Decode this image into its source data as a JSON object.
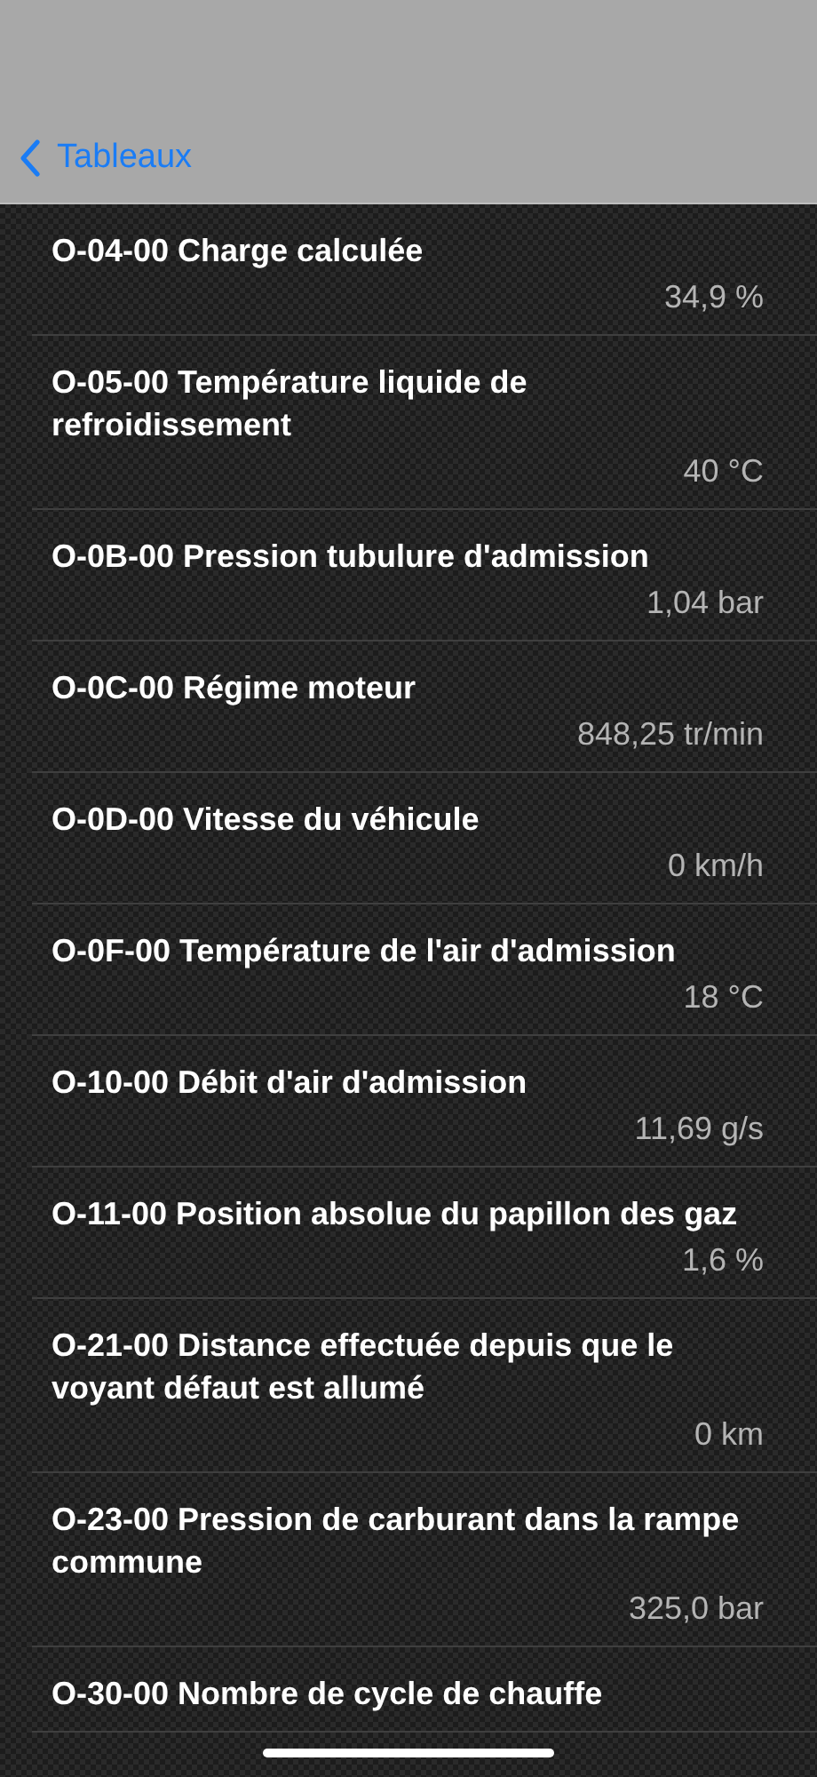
{
  "nav": {
    "back_label": "Tableaux"
  },
  "rows": [
    {
      "title": "O-04-00 Charge calculée",
      "value": "34,9 %"
    },
    {
      "title": "O-05-00 Température liquide de refroidissement",
      "value": "40 °C"
    },
    {
      "title": "O-0B-00 Pression tubulure d'admission",
      "value": "1,04 bar"
    },
    {
      "title": "O-0C-00 Régime moteur",
      "value": "848,25 tr/min"
    },
    {
      "title": "O-0D-00 Vitesse du véhicule",
      "value": "0 km/h"
    },
    {
      "title": "O-0F-00 Température de l'air d'admission",
      "value": "18 °C"
    },
    {
      "title": "O-10-00 Débit d'air d'admission",
      "value": "11,69 g/s"
    },
    {
      "title": "O-11-00 Position absolue du papillon des gaz",
      "value": "1,6 %"
    },
    {
      "title": "O-21-00 Distance effectuée depuis que le voyant défaut est allumé",
      "value": "0 km"
    },
    {
      "title": "O-23-00 Pression de carburant dans la rampe commune",
      "value": "325,0 bar"
    },
    {
      "title": "O-30-00 Nombre de cycle de chauffe"
    }
  ]
}
